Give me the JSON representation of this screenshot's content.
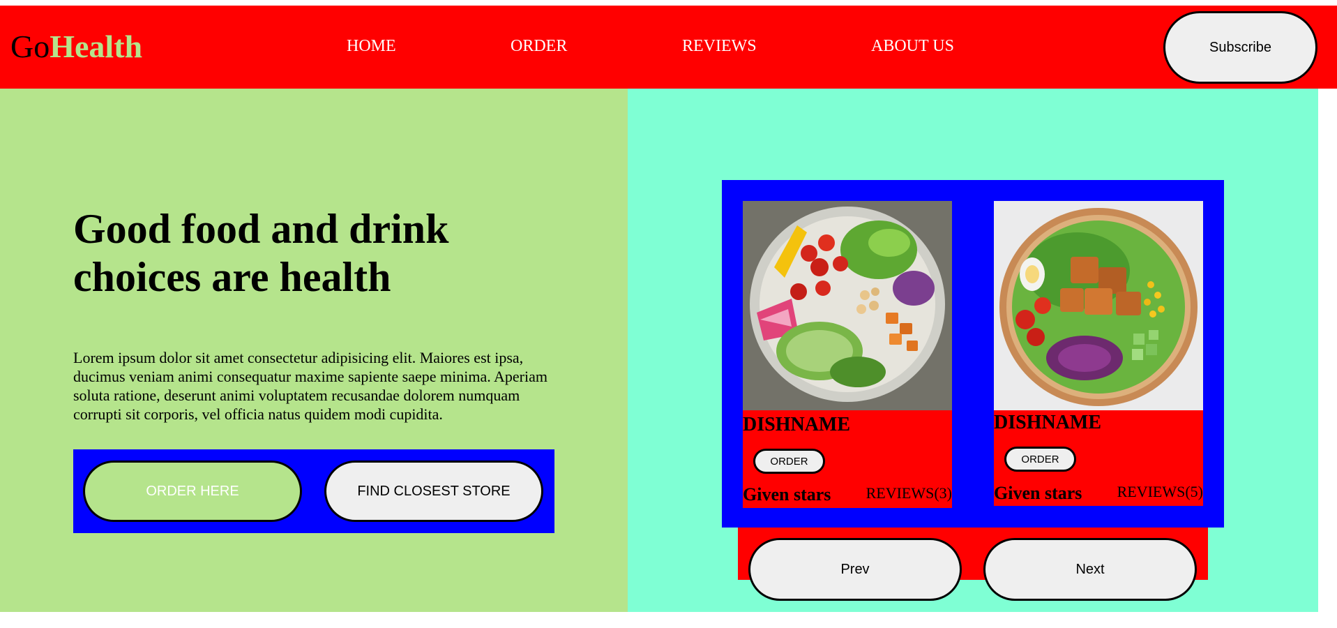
{
  "header": {
    "logo_go": "Go",
    "logo_health": "Health",
    "nav": [
      {
        "label": "HOME"
      },
      {
        "label": "ORDER"
      },
      {
        "label": "REVIEWS"
      },
      {
        "label": "ABOUT US"
      }
    ],
    "subscribe_label": "Subscribe"
  },
  "hero": {
    "title": "Good food and drink choices are health",
    "body": "Lorem ipsum dolor sit amet consectetur adipisicing elit. Maiores est ipsa, ducimus veniam animi consequatur maxime sapiente saepe minima. Aperiam soluta ratione, deserunt animi voluptatem recusandae dolorem numquam corrupti sit corporis, vel officia natus quidem modi cupidita.",
    "order_button": "ORDER HERE",
    "store_button": "FIND CLOSEST STORE"
  },
  "cards": [
    {
      "dish_name": "DISHNAME",
      "order_label": "ORDER",
      "stars_label": "Given stars",
      "reviews_label": "REVIEWS(3)"
    },
    {
      "dish_name": "DISHNAME",
      "order_label": "ORDER",
      "stars_label": "Given stars",
      "reviews_label": "REVIEWS(5)"
    }
  ],
  "pager": {
    "prev_label": "Prev",
    "next_label": "Next"
  },
  "colors": {
    "header_bg": "#ff0000",
    "left_bg": "#b5e48c",
    "right_bg": "#7fffd4",
    "frame_blue": "#0000ff",
    "button_bg": "#efefef"
  }
}
